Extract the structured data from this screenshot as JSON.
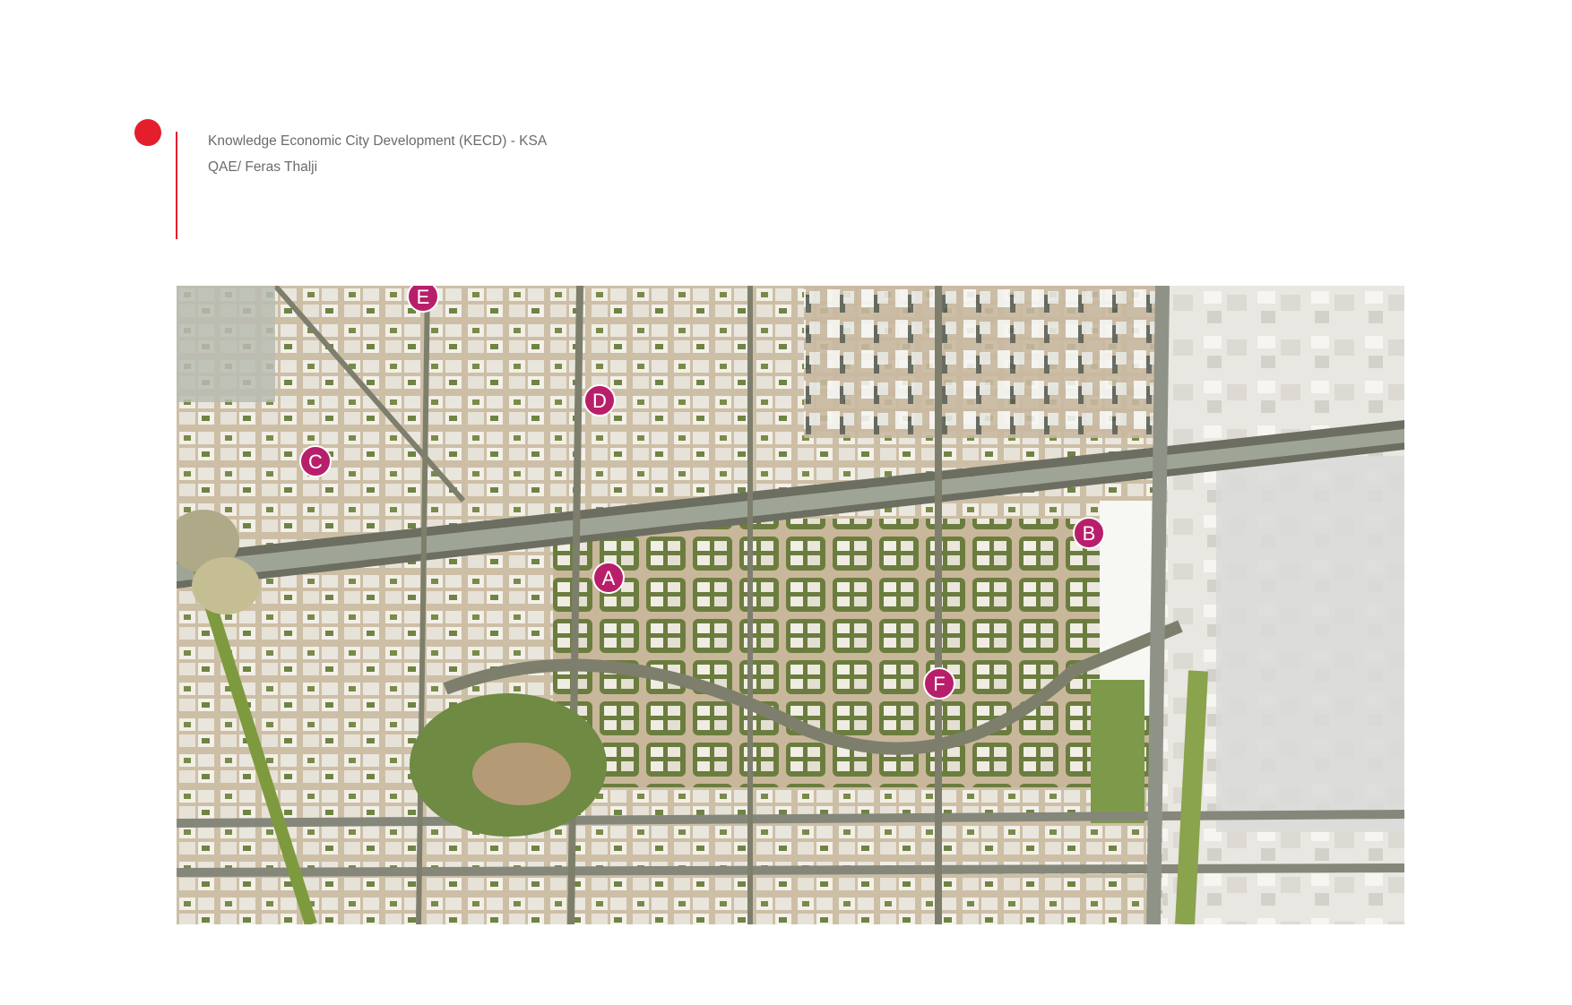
{
  "header": {
    "project_title": "Knowledge Economic City Development (KECD) - KSA",
    "credit": "QAE/ Feras Thalji"
  },
  "colors": {
    "accent_red": "#e41e2b",
    "marker_magenta": "#b81f6a",
    "header_text": "#6b6b6b"
  },
  "site_plan": {
    "markers": [
      {
        "id": "E",
        "label": "E"
      },
      {
        "id": "D",
        "label": "D"
      },
      {
        "id": "C",
        "label": "C"
      },
      {
        "id": "A",
        "label": "A"
      },
      {
        "id": "B",
        "label": "B"
      },
      {
        "id": "F",
        "label": "F"
      }
    ]
  }
}
